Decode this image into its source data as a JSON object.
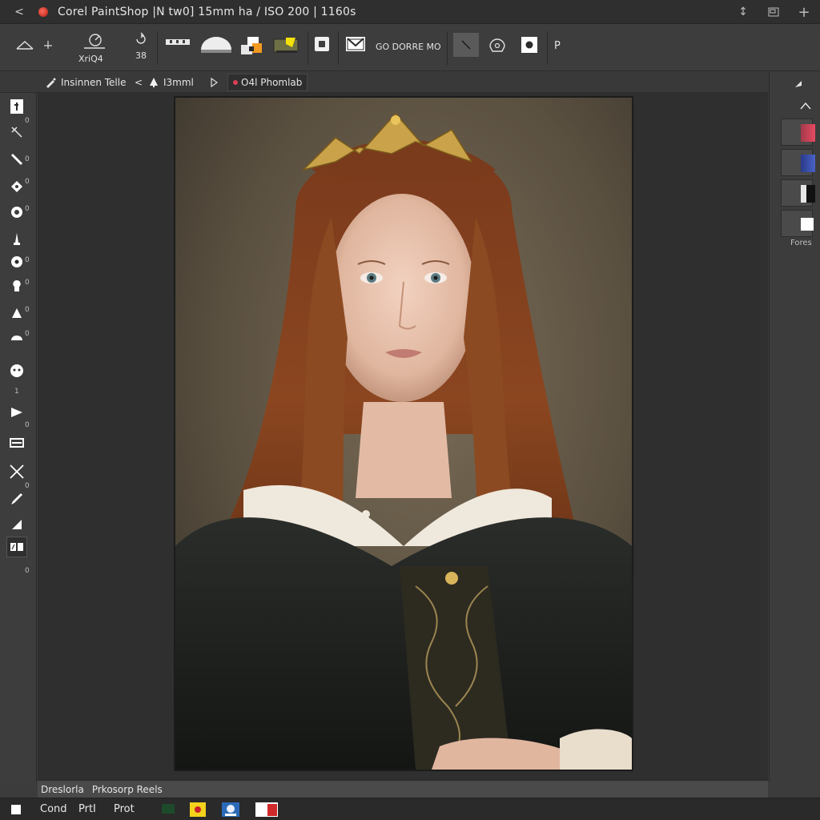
{
  "window": {
    "title": "Corel PaintShop [N tm0] 15mm f/4 / ISO 200 | 1160s",
    "title_display": "Corel PaintShop |N tw0] 15mm ha  / ISO  200 |   1160s"
  },
  "toolbar": {
    "zoom_label": "XriQ4",
    "small_label": "38",
    "text_label": "GO DORRE MO",
    "last_label": "P"
  },
  "options_bar": {
    "tool_name": "Insinnen Telle",
    "size_value": "I3mml",
    "tab_label": "O4l Phomlab"
  },
  "right_panel": {
    "caption": "Fores"
  },
  "status_bar": {
    "left_text": "Dreslorla",
    "right_text": "Prkosorp Reels"
  },
  "taskbar": {
    "item1": "Cond",
    "item2": "PrtI",
    "item3": "Prot"
  },
  "left_tools": {
    "mini_labels": [
      "0",
      "0",
      "0",
      "0",
      "0",
      "0",
      "0",
      "0",
      "1",
      "0",
      "0",
      "0"
    ]
  },
  "colors": {
    "accent_red": "#d94155",
    "accent_blue": "#3550a8",
    "window_bg": "#3c3c3c",
    "canvas_bg": "#2f2f2f"
  }
}
